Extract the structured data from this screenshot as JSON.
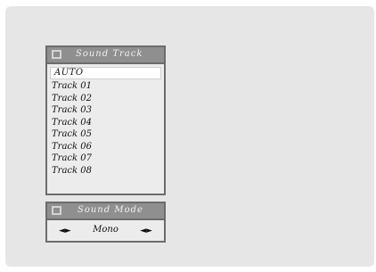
{
  "sound_track": {
    "title": "Sound Track",
    "selected": "AUTO",
    "items": [
      "Track 01",
      "Track 02",
      "Track 03",
      "Track 04",
      "Track 05",
      "Track 06",
      "Track 07",
      "Track 08"
    ]
  },
  "sound_mode": {
    "title": "Sound Mode",
    "value": "Mono",
    "left_icon": "arrow-left-icon",
    "right_icon": "arrow-right-icon"
  }
}
